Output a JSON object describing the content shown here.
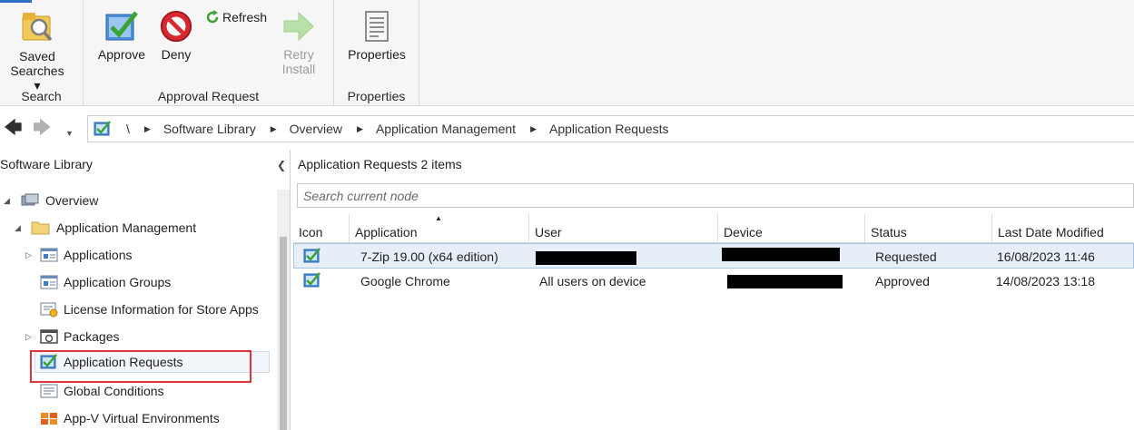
{
  "ribbon": {
    "groups": {
      "search": {
        "label": "Search",
        "saved_searches": {
          "line1": "Saved",
          "line2": "Searches ▾"
        }
      },
      "approval": {
        "label": "Approval Request",
        "approve": "Approve",
        "deny": "Deny",
        "refresh": "Refresh",
        "retry": {
          "line1": "Retry",
          "line2": "Install"
        }
      },
      "properties": {
        "label": "Properties",
        "properties_button": "Properties"
      }
    }
  },
  "address_bar": {
    "root": "\\",
    "crumbs": [
      "Software Library",
      "Overview",
      "Application Management",
      "Application Requests"
    ]
  },
  "tree": {
    "title": "Software Library",
    "items": [
      {
        "label": "Overview"
      },
      {
        "label": "Application Management"
      },
      {
        "label": "Applications"
      },
      {
        "label": "Application Groups"
      },
      {
        "label": "License Information for Store Apps"
      },
      {
        "label": "Packages"
      },
      {
        "label": "Application Requests"
      },
      {
        "label": "Global Conditions"
      },
      {
        "label": "App-V Virtual Environments"
      }
    ]
  },
  "main": {
    "header": {
      "title": "Application Requests",
      "count": "2 items"
    },
    "search": {
      "placeholder": "Search current node"
    },
    "columns": [
      "Icon",
      "Application",
      "User",
      "Device",
      "Status",
      "Last Date Modified"
    ],
    "rows": [
      {
        "application": "7-Zip 19.00 (x64 edition)",
        "user": "",
        "device": "",
        "status": "Requested",
        "modified": "16/08/2023 11:46"
      },
      {
        "application": "Google Chrome",
        "user": "All users on device",
        "device": "",
        "status": "Approved",
        "modified": "14/08/2023 13:18"
      }
    ]
  },
  "colors": {
    "accent": "#2a6fc9",
    "highlight_border": "#e0343b",
    "selection": "#e6eef8",
    "check_green": "#3aa335"
  }
}
